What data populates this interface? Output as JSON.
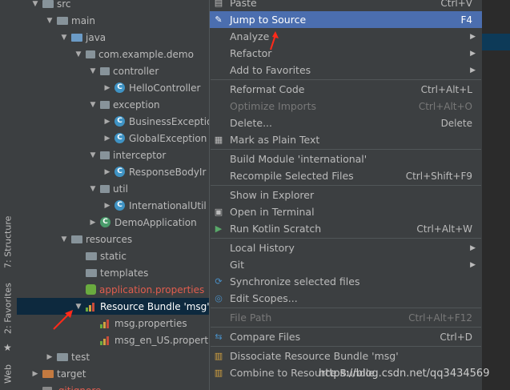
{
  "tool_tabs": {
    "structure": "7: Structure",
    "favorites": "2: Favorites",
    "web": "Web"
  },
  "tree": {
    "items": [
      {
        "label": "src",
        "depth": 0,
        "expanded": true,
        "icon": "folder"
      },
      {
        "label": "main",
        "depth": 1,
        "expanded": true,
        "icon": "folder"
      },
      {
        "label": "java",
        "depth": 2,
        "expanded": true,
        "icon": "folder-blue"
      },
      {
        "label": "com.example.demo",
        "depth": 3,
        "expanded": true,
        "icon": "package"
      },
      {
        "label": "controller",
        "depth": 4,
        "expanded": true,
        "icon": "package"
      },
      {
        "label": "HelloController",
        "depth": 5,
        "expanded": false,
        "icon": "class"
      },
      {
        "label": "exception",
        "depth": 4,
        "expanded": true,
        "icon": "package"
      },
      {
        "label": "BusinessExceptio",
        "depth": 5,
        "expanded": false,
        "icon": "class"
      },
      {
        "label": "GlobalException",
        "depth": 5,
        "expanded": false,
        "icon": "class"
      },
      {
        "label": "interceptor",
        "depth": 4,
        "expanded": true,
        "icon": "package"
      },
      {
        "label": "ResponseBodyIr",
        "depth": 5,
        "expanded": false,
        "icon": "class"
      },
      {
        "label": "util",
        "depth": 4,
        "expanded": true,
        "icon": "package"
      },
      {
        "label": "InternationalUtil",
        "depth": 5,
        "expanded": false,
        "icon": "class"
      },
      {
        "label": "DemoApplication",
        "depth": 4,
        "expanded": false,
        "icon": "class-app"
      },
      {
        "label": "resources",
        "depth": 2,
        "expanded": true,
        "icon": "folder-res"
      },
      {
        "label": "static",
        "depth": 3,
        "icon": "folder"
      },
      {
        "label": "templates",
        "depth": 3,
        "icon": "folder"
      },
      {
        "label": "application.properties",
        "depth": 3,
        "icon": "spring-leaf",
        "color": "#e05d4e"
      },
      {
        "label": "Resource Bundle 'msg'",
        "depth": 3,
        "expanded": true,
        "icon": "bundle",
        "selected": true
      },
      {
        "label": "msg.properties",
        "depth": 4,
        "icon": "bundle"
      },
      {
        "label": "msg_en_US.propert",
        "depth": 4,
        "icon": "bundle"
      },
      {
        "label": "test",
        "depth": 1,
        "expanded": false,
        "icon": "folder"
      },
      {
        "label": "target",
        "depth": 0,
        "expanded": false,
        "icon": "folder-orange"
      },
      {
        "label": ".gitignore",
        "depth": 0,
        "icon": "file",
        "color": "#e05d4e"
      }
    ]
  },
  "menu": {
    "items": [
      {
        "label": "Paste",
        "shortcut": "Ctrl+V",
        "icon": "clipboard-icon"
      },
      {
        "label": "Jump to Source",
        "shortcut": "F4",
        "icon": "pencil-icon",
        "highlighted": true
      },
      {
        "label": "Analyze",
        "submenu": true
      },
      {
        "label": "Refactor",
        "submenu": true
      },
      {
        "label": "Add to Favorites",
        "submenu": true
      },
      {
        "sep": true
      },
      {
        "label": "Reformat Code",
        "shortcut": "Ctrl+Alt+L"
      },
      {
        "label": "Optimize Imports",
        "shortcut": "Ctrl+Alt+O",
        "disabled": true
      },
      {
        "label": "Delete...",
        "shortcut": "Delete"
      },
      {
        "label": "Mark as Plain Text",
        "icon": "text-icon"
      },
      {
        "sep": true
      },
      {
        "label": "Build Module 'international'"
      },
      {
        "label": "Recompile Selected Files",
        "shortcut": "Ctrl+Shift+F9"
      },
      {
        "sep": true
      },
      {
        "label": "Show in Explorer"
      },
      {
        "label": "Open in Terminal",
        "icon": "terminal-icon"
      },
      {
        "label": "Run Kotlin Scratch",
        "shortcut": "Ctrl+Alt+W",
        "icon": "run-icon"
      },
      {
        "sep": true
      },
      {
        "label": "Local History",
        "submenu": true
      },
      {
        "label": "Git",
        "submenu": true
      },
      {
        "label": "Synchronize selected files",
        "icon": "sync-icon"
      },
      {
        "label": "Edit Scopes...",
        "icon": "scope-icon"
      },
      {
        "sep": true
      },
      {
        "label": "File Path",
        "shortcut": "Ctrl+Alt+F12",
        "disabled": true
      },
      {
        "sep": true
      },
      {
        "label": "Compare Files",
        "shortcut": "Ctrl+D",
        "icon": "compare-icon"
      },
      {
        "sep": true
      },
      {
        "label": "Dissociate Resource Bundle 'msg'",
        "icon": "bundle-icon"
      },
      {
        "label": "Combine to Resource Bundle",
        "icon": "bundle-icon"
      }
    ]
  },
  "watermark": "https://blog.csdn.net/qq3434569",
  "colors": {
    "highlight": "#4b6eaf",
    "selected_row": "#0d293e",
    "annotation_arrow": "#ff2a1a"
  }
}
